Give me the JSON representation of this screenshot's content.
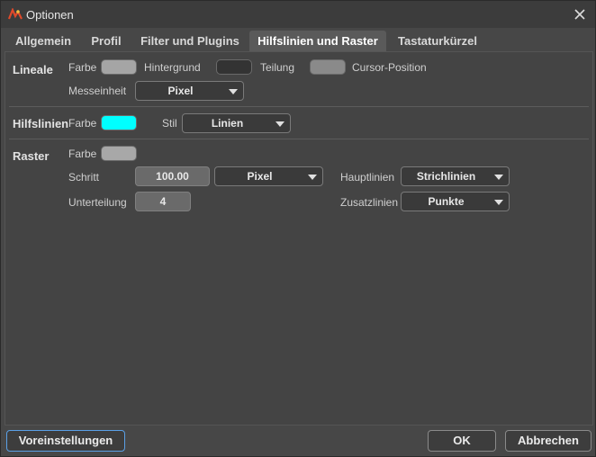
{
  "window": {
    "title": "Optionen"
  },
  "tabs": [
    {
      "label": "Allgemein",
      "active": false
    },
    {
      "label": "Profil",
      "active": false
    },
    {
      "label": "Filter und Plugins",
      "active": false
    },
    {
      "label": "Hilfslinien und Raster",
      "active": true
    },
    {
      "label": "Tastaturkürzel",
      "active": false
    }
  ],
  "lineale": {
    "title": "Lineale",
    "farbe_label": "Farbe",
    "farbe_color": "#a5a5a5",
    "hintergrund_label": "Hintergrund",
    "hintergrund_color": "#333333",
    "teilung_label": "Teilung",
    "teilung_color": "#8a8a8a",
    "cursor_label": "Cursor-Position",
    "messeinheit_label": "Messeinheit",
    "messeinheit_value": "Pixel"
  },
  "hilfslinien": {
    "title": "Hilfslinien",
    "farbe_label": "Farbe",
    "farbe_color": "#00ffff",
    "stil_label": "Stil",
    "stil_value": "Linien"
  },
  "raster": {
    "title": "Raster",
    "farbe_label": "Farbe",
    "farbe_color": "#a8a8a8",
    "schritt_label": "Schritt",
    "schritt_value": "100.00",
    "einheit_value": "Pixel",
    "hauptlinien_label": "Hauptlinien",
    "hauptlinien_value": "Strichlinien",
    "unterteilung_label": "Unterteilung",
    "unterteilung_value": "4",
    "zusatzlinien_label": "Zusatzlinien",
    "zusatzlinien_value": "Punkte"
  },
  "footer": {
    "defaults_label": "Voreinstellungen",
    "ok_label": "OK",
    "cancel_label": "Abbrechen"
  },
  "icons": {
    "app": "app-logo-icon",
    "close": "close-icon"
  }
}
